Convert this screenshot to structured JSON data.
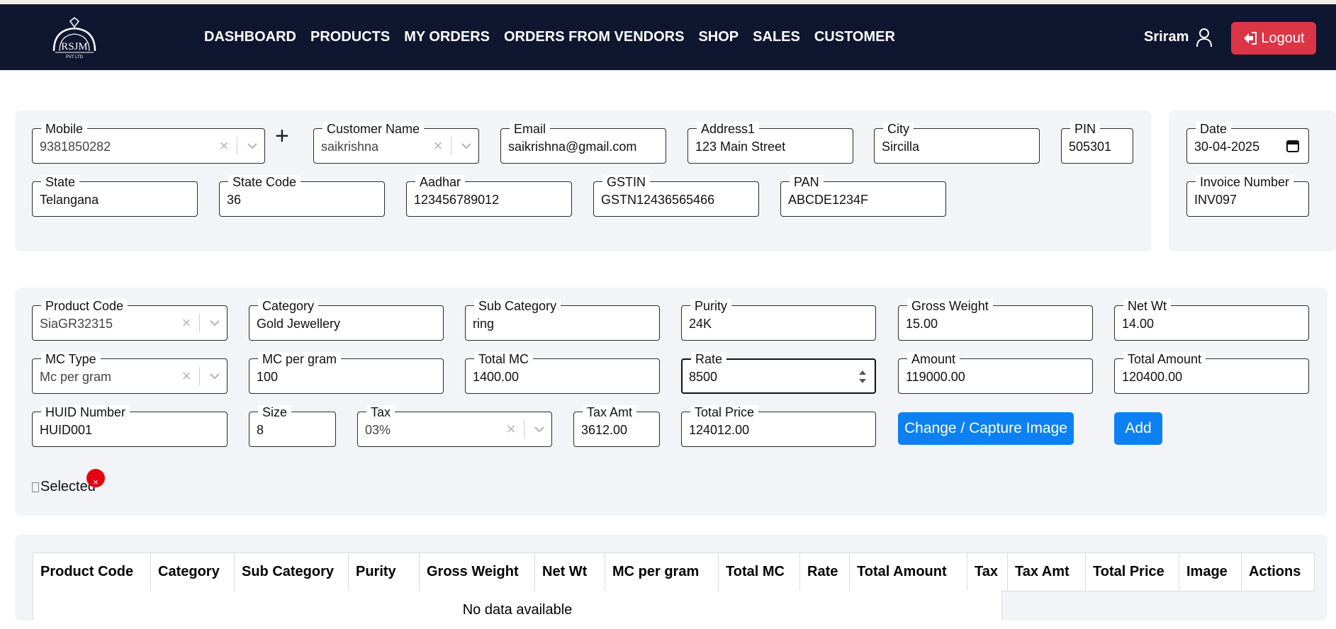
{
  "brand": {
    "logo_text": "RSJM",
    "logo_sub": "PVT LTD"
  },
  "nav": {
    "items": [
      "DASHBOARD",
      "PRODUCTS",
      "MY ORDERS",
      "ORDERS FROM VENDORS",
      "SHOP",
      "SALES",
      "CUSTOMER"
    ],
    "user_name": "Sriram",
    "logout_label": "Logout"
  },
  "customer": {
    "mobile": {
      "label": "Mobile",
      "value": "9381850282"
    },
    "customer_name": {
      "label": "Customer Name",
      "value": "saikrishna"
    },
    "email": {
      "label": "Email",
      "value": "saikrishna@gmail.com"
    },
    "address1": {
      "label": "Address1",
      "value": "123 Main Street"
    },
    "city": {
      "label": "City",
      "value": "Sircilla"
    },
    "pin": {
      "label": "PIN",
      "value": "505301"
    },
    "state": {
      "label": "State",
      "value": "Telangana"
    },
    "state_code": {
      "label": "State Code",
      "value": "36"
    },
    "aadhar": {
      "label": "Aadhar",
      "value": "123456789012"
    },
    "gstin": {
      "label": "GSTIN",
      "value": "GSTN12436565466"
    },
    "pan": {
      "label": "PAN",
      "value": "ABCDE1234F"
    }
  },
  "invoice": {
    "date": {
      "label": "Date",
      "value": "30-04-2025"
    },
    "invoice_number": {
      "label": "Invoice Number",
      "value": "INV097"
    }
  },
  "product": {
    "product_code": {
      "label": "Product Code",
      "value": "SiaGR32315"
    },
    "category": {
      "label": "Category",
      "value": "Gold Jewellery"
    },
    "sub_category": {
      "label": "Sub Category",
      "value": "ring"
    },
    "purity": {
      "label": "Purity",
      "value": "24K"
    },
    "gross_weight": {
      "label": "Gross Weight",
      "value": "15.00"
    },
    "net_wt": {
      "label": "Net Wt",
      "value": "14.00"
    },
    "mc_type": {
      "label": "MC Type",
      "value": "Mc per gram"
    },
    "mc_per_gram": {
      "label": "MC per gram",
      "value": "100"
    },
    "total_mc": {
      "label": "Total MC",
      "value": "1400.00"
    },
    "rate": {
      "label": "Rate",
      "value": "8500"
    },
    "amount": {
      "label": "Amount",
      "value": "119000.00"
    },
    "total_amount": {
      "label": "Total Amount",
      "value": "120400.00"
    },
    "huid": {
      "label": "HUID Number",
      "value": "HUID001"
    },
    "size": {
      "label": "Size",
      "value": "8"
    },
    "tax": {
      "label": "Tax",
      "value": "03%"
    },
    "tax_amt": {
      "label": "Tax Amt",
      "value": "3612.00"
    },
    "total_price": {
      "label": "Total Price",
      "value": "124012.00"
    },
    "capture_label": "Change / Capture Image",
    "add_label": "Add",
    "image_alt": "Selected",
    "remove_glyph": "×"
  },
  "table": {
    "headers": [
      "Product Code",
      "Category",
      "Sub Category",
      "Purity",
      "Gross Weight",
      "Net Wt",
      "MC per gram",
      "Total MC",
      "Rate",
      "Total Amount",
      "Tax",
      "Tax Amt",
      "Total Price",
      "Image",
      "Actions"
    ],
    "empty_text": "No data available"
  },
  "colors": {
    "navbar": "#0f1630",
    "logout": "#dc3545",
    "primary": "#0d80f2",
    "remove": "#e60012"
  }
}
